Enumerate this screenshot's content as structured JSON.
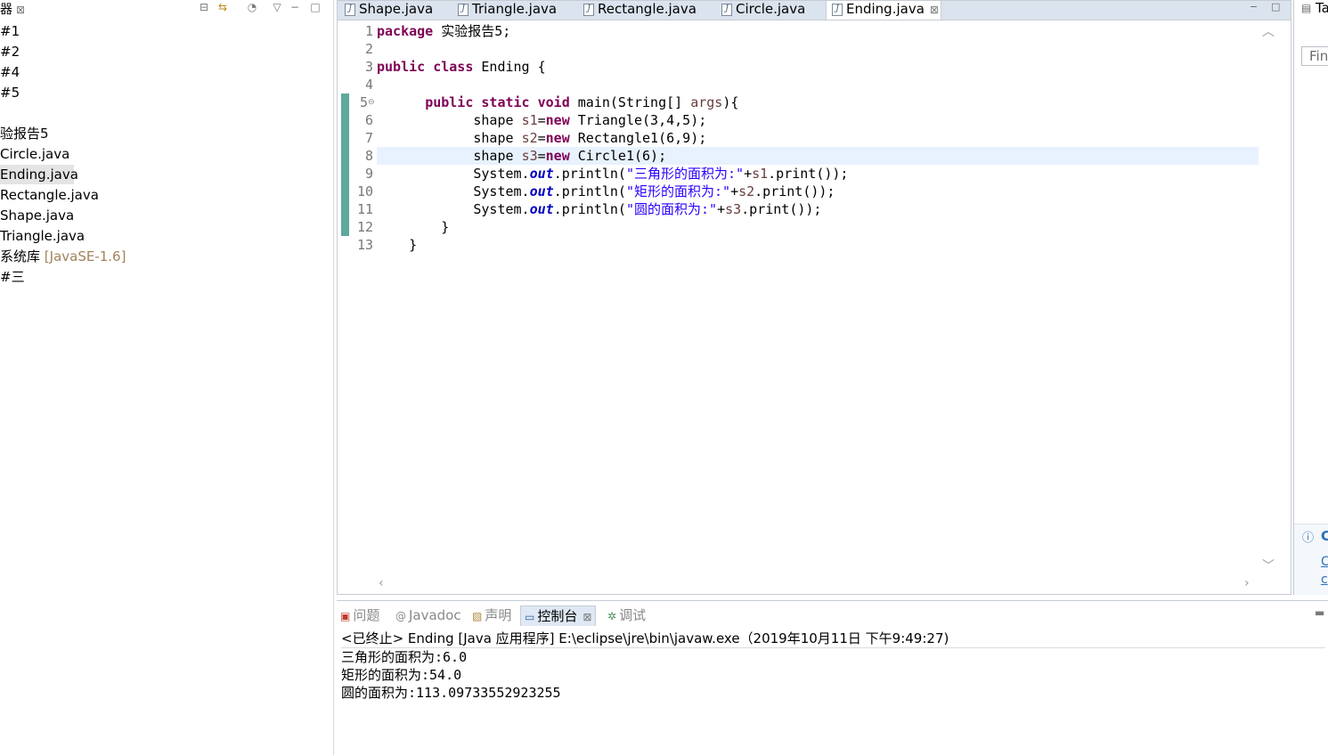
{
  "explorer": {
    "title": "器",
    "items": [
      {
        "label": "#1"
      },
      {
        "label": "#2"
      },
      {
        "label": "#4"
      },
      {
        "label": "#5"
      },
      {
        "label": "验报告5"
      },
      {
        "label": "Circle.java"
      },
      {
        "label": "Ending.java"
      },
      {
        "label": "Rectangle.java"
      },
      {
        "label": "Shape.java"
      },
      {
        "label": "Triangle.java"
      },
      {
        "label": "系统库",
        "suffix": "[JavaSE-1.6]"
      },
      {
        "label": "#三"
      }
    ]
  },
  "editor": {
    "tabs": [
      {
        "label": "Shape.java"
      },
      {
        "label": "Triangle.java"
      },
      {
        "label": "Rectangle.java"
      },
      {
        "label": "Circle.java"
      },
      {
        "label": "Ending.java"
      }
    ],
    "active_tab": "Ending.java",
    "line_numbers": [
      "1",
      "2",
      "3",
      "4",
      "5",
      "6",
      "7",
      "8",
      "9",
      "10",
      "11",
      "12",
      "13"
    ],
    "current_line": 8
  },
  "right_panel": {
    "tab_label": "Ta",
    "find_placeholder": "Fin"
  },
  "console": {
    "tabs": [
      {
        "label": "问题",
        "icon": "problems-icon"
      },
      {
        "label": "Javadoc",
        "icon": "javadoc-icon"
      },
      {
        "label": "声明",
        "icon": "declaration-icon"
      },
      {
        "label": "控制台",
        "icon": "console-icon"
      },
      {
        "label": "调试",
        "icon": "debug-icon"
      }
    ],
    "active_tab": "控制台",
    "header": "<已终止> Ending [Java 应用程序] E:\\eclipse\\jre\\bin\\javaw.exe（2019年10月11日 下午9:49:27)",
    "output": [
      "三角形的面积为:6.0",
      "矩形的面积为:54.0",
      "圆的面积为:113.09733552923255"
    ]
  },
  "colors": {
    "keyword": "#7f0055",
    "string": "#2a00ff",
    "field": "#0000c0",
    "local_var": "#6a3e3e",
    "current_line_bg": "#e8f2fe",
    "change_bar": "#5ea89c"
  }
}
